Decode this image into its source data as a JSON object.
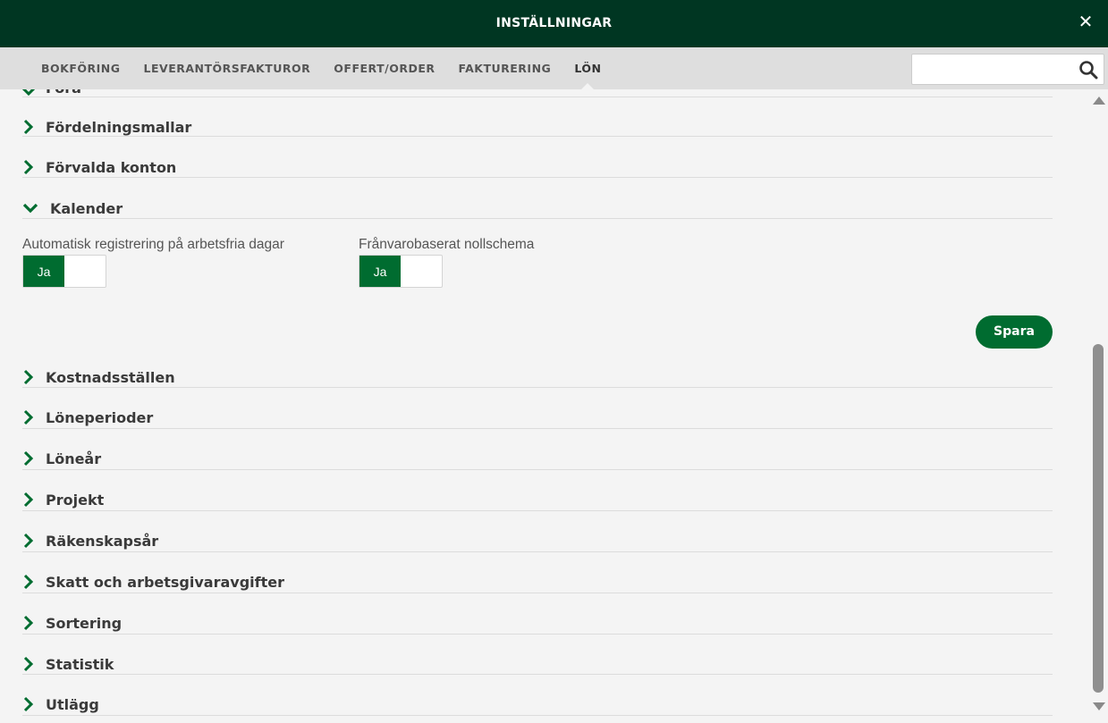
{
  "window": {
    "title": "INSTÄLLNINGAR",
    "close_icon": "close-icon"
  },
  "tabs": [
    {
      "label": "BOKFÖRING",
      "active": false
    },
    {
      "label": "LEVERANTÖRSFAKTUROR",
      "active": false
    },
    {
      "label": "OFFERT/ORDER",
      "active": false
    },
    {
      "label": "FAKTURERING",
      "active": false
    },
    {
      "label": "LÖN",
      "active": true
    }
  ],
  "search": {
    "value": "",
    "placeholder": "",
    "icon": "search-icon"
  },
  "sections_above": [
    {
      "label": "Fora",
      "expanded": false
    },
    {
      "label": "Fördelningsmallar",
      "expanded": false
    },
    {
      "label": "Förvalda konton",
      "expanded": false
    }
  ],
  "calendar": {
    "label": "Kalender",
    "expanded": true,
    "settings": [
      {
        "label": "Automatisk registrering på arbetsfria dagar",
        "toggle_label": "Ja",
        "value": true
      },
      {
        "label": "Frånvarobaserat nollschema",
        "toggle_label": "Ja",
        "value": true
      }
    ],
    "save_label": "Spara"
  },
  "sections_below": [
    {
      "label": "Kostnadsställen",
      "expanded": false
    },
    {
      "label": "Löneperioder",
      "expanded": false
    },
    {
      "label": "Löneår",
      "expanded": false
    },
    {
      "label": "Projekt",
      "expanded": false
    },
    {
      "label": "Räkenskapsår",
      "expanded": false
    },
    {
      "label": "Skatt och arbetsgivaravgifter",
      "expanded": false
    },
    {
      "label": "Sortering",
      "expanded": false
    },
    {
      "label": "Statistik",
      "expanded": false
    },
    {
      "label": "Utlägg",
      "expanded": false
    }
  ],
  "colors": {
    "header_bg": "#003622",
    "accent": "#006c30",
    "content_bg": "#f4f4f4"
  }
}
